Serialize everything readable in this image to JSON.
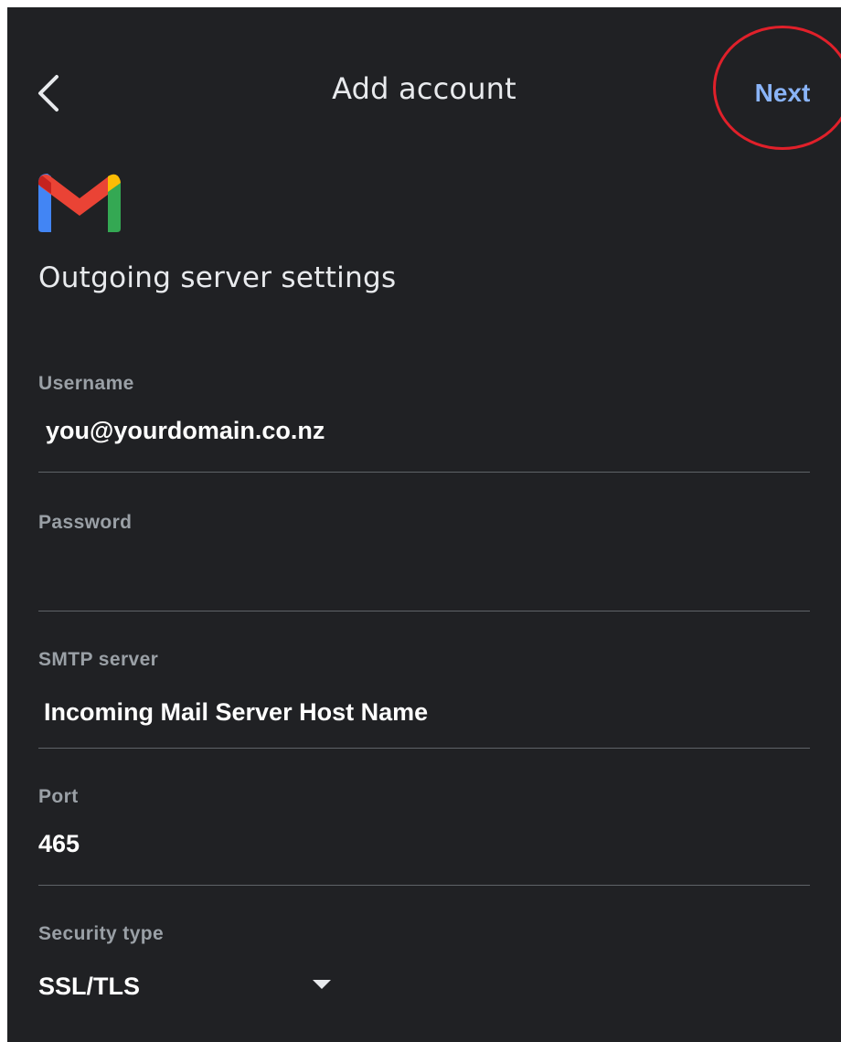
{
  "header": {
    "title": "Add account",
    "next_label": "Next",
    "back_icon": "chevron-left-icon"
  },
  "logo": {
    "icon": "gmail-logo"
  },
  "page": {
    "heading": "Outgoing server settings"
  },
  "fields": {
    "username": {
      "label": "Username",
      "value": "you@yourdomain.co.nz"
    },
    "password": {
      "label": "Password",
      "value": ""
    },
    "smtp_server": {
      "label": "SMTP server",
      "value": "Incoming Mail Server Host Name"
    },
    "port": {
      "label": "Port",
      "value": "465"
    },
    "security_type": {
      "label": "Security type",
      "value": "SSL/TLS",
      "icon": "dropdown-arrow-icon"
    }
  },
  "colors": {
    "background": "#202124",
    "accent": "#8ab4f8",
    "annotation_circle": "#e0202a",
    "label": "#9aa0a6",
    "divider": "#5f6368"
  }
}
